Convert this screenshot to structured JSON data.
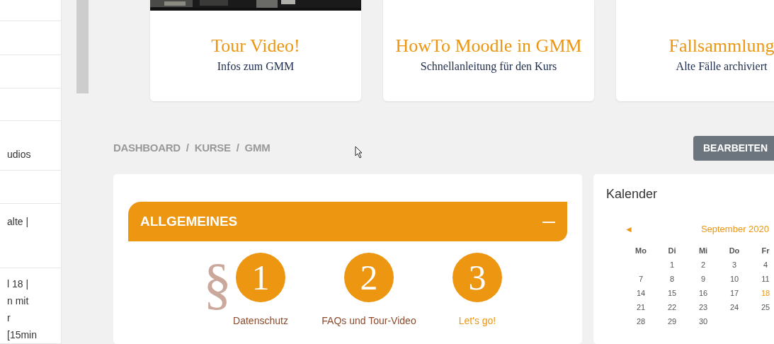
{
  "sidebar": {
    "items": [
      {
        "lines": [
          "udios"
        ]
      },
      {
        "lines": [
          "alte |"
        ]
      },
      {
        "lines": [
          "l 18 |",
          "n mit",
          "r",
          "[15min"
        ]
      }
    ]
  },
  "cards": [
    {
      "title": "Tour Video!",
      "subtitle": "Infos zum GMM",
      "has_image": true
    },
    {
      "title": "HowTo Moodle in GMM",
      "subtitle": "Schnellanleitung für den Kurs",
      "has_image": false
    },
    {
      "title": "Fallsammlung",
      "subtitle": "Alte Fälle archiviert",
      "has_image": false
    }
  ],
  "breadcrumb": [
    "DASHBOARD",
    "KURSE",
    "GMM"
  ],
  "breadcrumb_separator": "/",
  "edit_button": "BEARBEITEN",
  "section": {
    "title": "ALLGEMEINES",
    "collapse_symbol": "—",
    "expanded": true,
    "steps": [
      {
        "number": "1",
        "symbol": "§",
        "label": "Datenschutz",
        "color": "#8b4a2b"
      },
      {
        "number": "2",
        "label": "FAQs und Tour-Video",
        "color": "#8b4a2b"
      },
      {
        "number": "3",
        "label": "Let's go!",
        "color": "#ec9612"
      }
    ]
  },
  "calendar": {
    "title": "Kalender",
    "prev": "◄",
    "month": "September 2020",
    "weekdays": [
      "Mo",
      "Di",
      "Mi",
      "Do",
      "Fr"
    ],
    "weeks": [
      {
        "days": [
          {
            "day": "1",
            "today": false
          },
          {
            "day": "2",
            "today": false
          },
          {
            "day": "3",
            "today": false
          },
          {
            "day": "4",
            "today": false
          }
        ]
      },
      {
        "days": [
          {
            "day": "7",
            "today": false
          },
          {
            "day": "8",
            "today": false
          },
          {
            "day": "9",
            "today": false
          },
          {
            "day": "10",
            "today": false
          },
          {
            "day": "11",
            "today": false
          }
        ]
      },
      {
        "days": [
          {
            "day": "14",
            "today": false
          },
          {
            "day": "15",
            "today": false
          },
          {
            "day": "16",
            "today": false
          },
          {
            "day": "17",
            "today": false
          },
          {
            "day": "18",
            "today": true
          }
        ]
      },
      {
        "days": [
          {
            "day": "21",
            "today": false
          },
          {
            "day": "22",
            "today": false
          },
          {
            "day": "23",
            "today": false
          },
          {
            "day": "24",
            "today": false
          },
          {
            "day": "25",
            "today": false
          }
        ]
      },
      {
        "days": [
          {
            "day": "28",
            "today": false
          },
          {
            "day": "29",
            "today": false
          },
          {
            "day": "30",
            "today": false
          }
        ]
      }
    ]
  }
}
